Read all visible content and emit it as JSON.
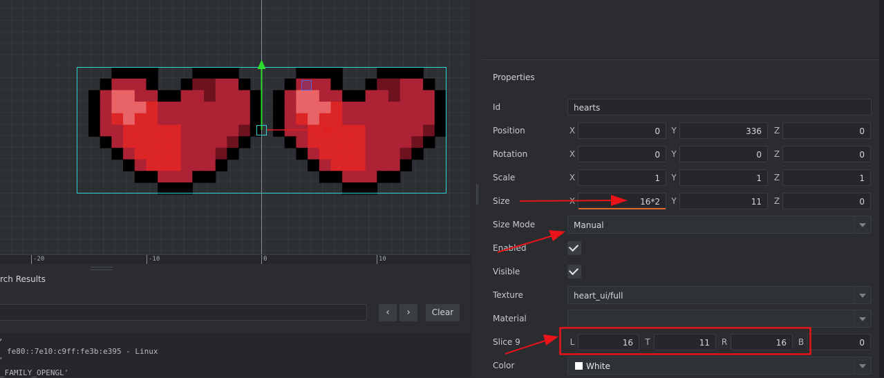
{
  "viewport": {
    "ruler_ticks": [
      "-20",
      "-10",
      "0",
      "10"
    ]
  },
  "search": {
    "title": "rch Results",
    "prev_icon": "chevron-left-icon",
    "next_icon": "chevron-right-icon",
    "prev_glyph": "‹",
    "next_glyph": "›",
    "clear_label": "Clear",
    "result_lines": [
      "fe80::7e10:c9ff:fe3b:e395 - Linux",
      "_FAMILY_OPENGL'"
    ],
    "result_fragments": [
      ",",
      "'"
    ]
  },
  "properties": {
    "title": "Properties",
    "id": {
      "label": "Id",
      "value": "hearts"
    },
    "position": {
      "label": "Position",
      "x_axis": "X",
      "y_axis": "Y",
      "z_axis": "Z",
      "x": "0",
      "y": "336",
      "z": "0"
    },
    "rotation": {
      "label": "Rotation",
      "x_axis": "X",
      "y_axis": "Y",
      "z_axis": "Z",
      "x": "0",
      "y": "0",
      "z": "0"
    },
    "scale": {
      "label": "Scale",
      "x_axis": "X",
      "y_axis": "Y",
      "z_axis": "Z",
      "x": "1",
      "y": "1",
      "z": "1"
    },
    "size": {
      "label": "Size",
      "x_axis": "X",
      "y_axis": "Y",
      "z_axis": "Z",
      "x": "16*2",
      "y": "11",
      "z": "0"
    },
    "size_mode": {
      "label": "Size Mode",
      "value": "Manual"
    },
    "enabled": {
      "label": "Enabled",
      "checked": true
    },
    "visible": {
      "label": "Visible",
      "checked": true
    },
    "texture": {
      "label": "Texture",
      "value": "heart_ui/full"
    },
    "material": {
      "label": "Material",
      "value": ""
    },
    "slice9": {
      "label": "Slice 9",
      "l_axis": "L",
      "t_axis": "T",
      "r_axis": "R",
      "b_axis": "B",
      "l": "16",
      "t": "11",
      "r": "16",
      "b": "0"
    },
    "color": {
      "label": "Color",
      "value": "White",
      "swatch": "#ffffff"
    }
  },
  "colors": {
    "selection": "#2fd6d6",
    "axis_y": "#2ddc2d",
    "axis_x": "#e02020",
    "annotation": "#e8141a",
    "heart_dark": "#ad2234",
    "heart_red": "#dc2526",
    "heart_light": "#e86466",
    "heart_deep": "#6e1220",
    "edit_underline": "#e0662b"
  }
}
